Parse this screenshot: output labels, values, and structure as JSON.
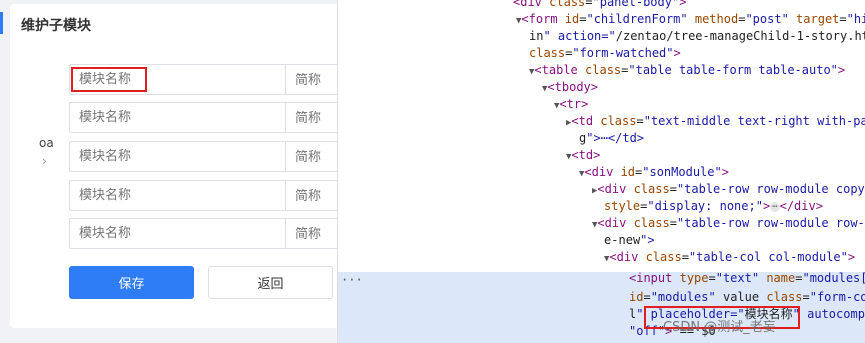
{
  "panel": {
    "title": "维护子模块",
    "side_label": "oa",
    "side_arrow": "›"
  },
  "rows": [
    {
      "name_placeholder": "模块名称",
      "abbr_placeholder": "简称"
    },
    {
      "name_placeholder": "模块名称",
      "abbr_placeholder": "简称"
    },
    {
      "name_placeholder": "模块名称",
      "abbr_placeholder": "简称"
    },
    {
      "name_placeholder": "模块名称",
      "abbr_placeholder": "简称"
    },
    {
      "name_placeholder": "模块名称",
      "abbr_placeholder": "简称"
    }
  ],
  "buttons": {
    "save": "保存",
    "back": "返回"
  },
  "devtools": {
    "lines": [
      {
        "t": "<div class=\"panel-body\">"
      },
      {
        "t": "▼<form id=\"childrenForm\" method=\"post\" target=\"hid"
      },
      {
        "t": "in\" action=\"/zentao/tree-manageChild-1-story.html"
      },
      {
        "t": "class=\"form-watched\">"
      },
      {
        "t": "▼<table class=\"table table-form table-auto\">"
      },
      {
        "t": "▼<tbody>"
      },
      {
        "t": "▼<tr>"
      },
      {
        "t": "▶<td class=\"text-middle text-right with-pad"
      },
      {
        "t": "g\">⋯</td>"
      },
      {
        "t": "▼<td>"
      },
      {
        "t": "▼<div id=\"sonModule\">"
      },
      {
        "t": "▶<div class=\"table-row row-module copy\""
      },
      {
        "t": "style=\"display: none;\">⋯</div>"
      },
      {
        "t": "▼<div class=\"table-row row-module row-m"
      },
      {
        "t": "e-new\">"
      },
      {
        "t": "▼<div class=\"table-col col-module\">"
      },
      {
        "t": "<input type=\"text\" name=\"modules[]\""
      },
      {
        "t": "id=\"modules\" value class=\"form-cont"
      },
      {
        "t": "l\" placeholder=\"模块名称\" autocomple"
      },
      {
        "t": "\"off\"> == $0"
      }
    ],
    "dots": "···",
    "watermark": "CSDN @测试_老妄"
  }
}
